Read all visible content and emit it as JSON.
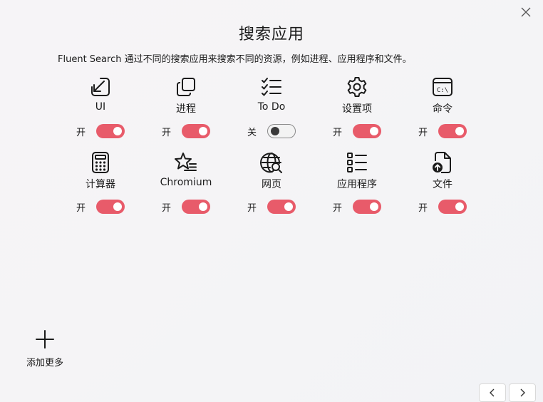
{
  "window": {
    "close_icon": "close-icon"
  },
  "header": {
    "title": "搜索应用",
    "description": "Fluent Search 通过不同的搜索应用来搜索不同的资源，例如进程、应用程序和文件。"
  },
  "colors": {
    "accent": "#e85b6a",
    "toggle_off_border": "#8a8a8a",
    "text": "#1b1b1b"
  },
  "apps": [
    {
      "label": "UI",
      "icon": "arrow-down-left-icon",
      "state_label": "开",
      "enabled": true
    },
    {
      "label": "进程",
      "icon": "windows-stack-icon",
      "state_label": "开",
      "enabled": true
    },
    {
      "label": "To Do",
      "icon": "checklist-icon",
      "state_label": "关",
      "enabled": false
    },
    {
      "label": "设置项",
      "icon": "gear-icon",
      "state_label": "开",
      "enabled": true
    },
    {
      "label": "命令",
      "icon": "terminal-icon",
      "state_label": "开",
      "enabled": true
    },
    {
      "label": "计算器",
      "icon": "calculator-icon",
      "state_label": "开",
      "enabled": true
    },
    {
      "label": "Chromium",
      "icon": "star-list-icon",
      "state_label": "开",
      "enabled": true
    },
    {
      "label": "网页",
      "icon": "globe-search-icon",
      "state_label": "开",
      "enabled": true
    },
    {
      "label": "应用程序",
      "icon": "app-list-icon",
      "state_label": "开",
      "enabled": true
    },
    {
      "label": "文件",
      "icon": "file-upload-icon",
      "state_label": "开",
      "enabled": true
    }
  ],
  "footer": {
    "add_more_label": "添加更多",
    "add_icon": "plus-icon",
    "prev_icon": "chevron-left-icon",
    "next_icon": "chevron-right-icon"
  }
}
